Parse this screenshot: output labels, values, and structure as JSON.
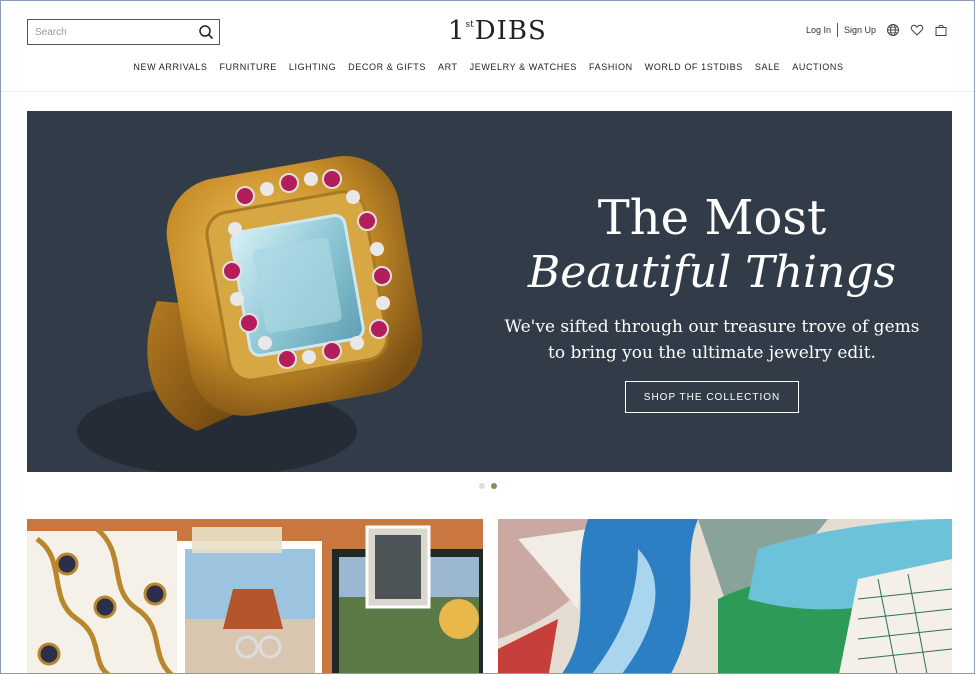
{
  "header": {
    "search_placeholder": "Search",
    "logo_one": "1",
    "logo_st": "st",
    "logo_rest": "DIBS",
    "login": "Log In",
    "signup": "Sign Up"
  },
  "nav": {
    "items": [
      "NEW ARRIVALS",
      "FURNITURE",
      "LIGHTING",
      "DECOR & GIFTS",
      "ART",
      "JEWELRY & WATCHES",
      "FASHION",
      "WORLD OF 1STDIBS",
      "SALE",
      "AUCTIONS"
    ]
  },
  "hero": {
    "title_line1": "The Most",
    "title_line2": "Beautiful Things",
    "subtitle": "We've sifted through our treasure trove of gems to bring you the ultimate jewelry edit.",
    "cta": "SHOP THE COLLECTION",
    "active_slide": 2,
    "slide_count": 2
  },
  "icons": {
    "search": "search-icon",
    "globe": "globe-icon",
    "heart": "heart-icon",
    "bag": "bag-icon"
  },
  "colors": {
    "hero_bg": "#323c48",
    "active_dot": "#8b8b53",
    "text": "#222222"
  }
}
